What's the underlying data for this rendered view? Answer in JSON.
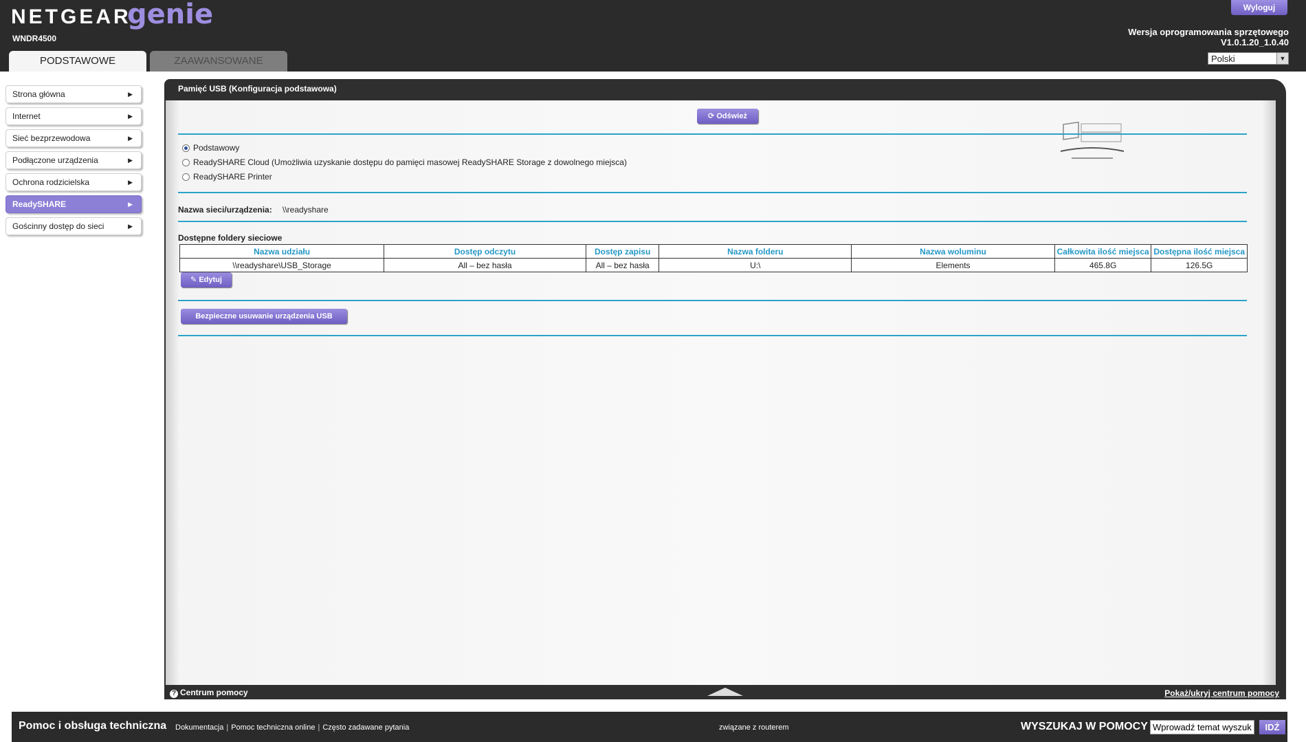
{
  "header": {
    "brand_netgear": "NETGEAR",
    "brand_genie": "genie",
    "brand_tm": "™",
    "model": "WNDR4500",
    "logout_label": "Wyloguj",
    "firmware_label": "Wersja oprogramowania sprzętowego",
    "firmware_version": "V1.0.1.20_1.0.40",
    "language": "Polski",
    "tabs": [
      {
        "label": "PODSTAWOWE",
        "active": true
      },
      {
        "label": "ZAAWANSOWANE",
        "active": false
      }
    ]
  },
  "sidebar": {
    "items": [
      {
        "label": "Strona główna"
      },
      {
        "label": "Internet"
      },
      {
        "label": "Sieć bezprzewodowa"
      },
      {
        "label": "Podłączone urządzenia"
      },
      {
        "label": "Ochrona rodzicielska"
      },
      {
        "label": "ReadySHARE",
        "active": true
      },
      {
        "label": "Gościnny dostęp do sieci"
      }
    ]
  },
  "panel": {
    "title": "Pamięć USB (Konfiguracja podstawowa)",
    "refresh_label": "Odśwież",
    "options": [
      {
        "label": "Podstawowy",
        "checked": true
      },
      {
        "label": "ReadySHARE Cloud (Umożliwia uzyskanie dostępu do pamięci masowej ReadySHARE Storage z dowolnego miejsca)",
        "checked": false
      },
      {
        "label": "ReadySHARE Printer",
        "checked": false
      }
    ],
    "network_name_label": "Nazwa sieci/urządzenia:",
    "network_name_value": "\\\\readyshare",
    "folders_title": "Dostępne foldery sieciowe",
    "table": {
      "headers": [
        "Nazwa udziału",
        "Dostęp odczytu",
        "Dostęp zapisu",
        "Nazwa folderu",
        "Nazwa woluminu",
        "Całkowita ilość miejsca",
        "Dostępna ilość miejsca"
      ],
      "rows": [
        [
          "\\\\readyshare\\USB_Storage",
          "All – bez hasła",
          "All – bez hasła",
          "U:\\",
          "Elements",
          "465.8G",
          "126.5G"
        ]
      ]
    },
    "edit_label": "Edytuj",
    "safe_remove_label": "Bezpieczne usuwanie urządzenia USB",
    "help_center_label": "Centrum pomocy",
    "toggle_help_label": "Pokaż/ukryj centrum pomocy"
  },
  "footer": {
    "title": "Pomoc i obsługa techniczna",
    "links": [
      "Dokumentacja",
      "Pomoc techniczna online",
      "Często zadawane pytania"
    ],
    "router_text": "związane z routerem",
    "search_label": "WYSZUKAJ W POMOCY",
    "search_value": "Wprowadź temat wyszuki",
    "go_label": "IDŹ"
  },
  "colors": {
    "accent_purple": "#8c7fd6",
    "separator_blue": "#2aa3c9",
    "header_bg": "#2b2b2b"
  }
}
